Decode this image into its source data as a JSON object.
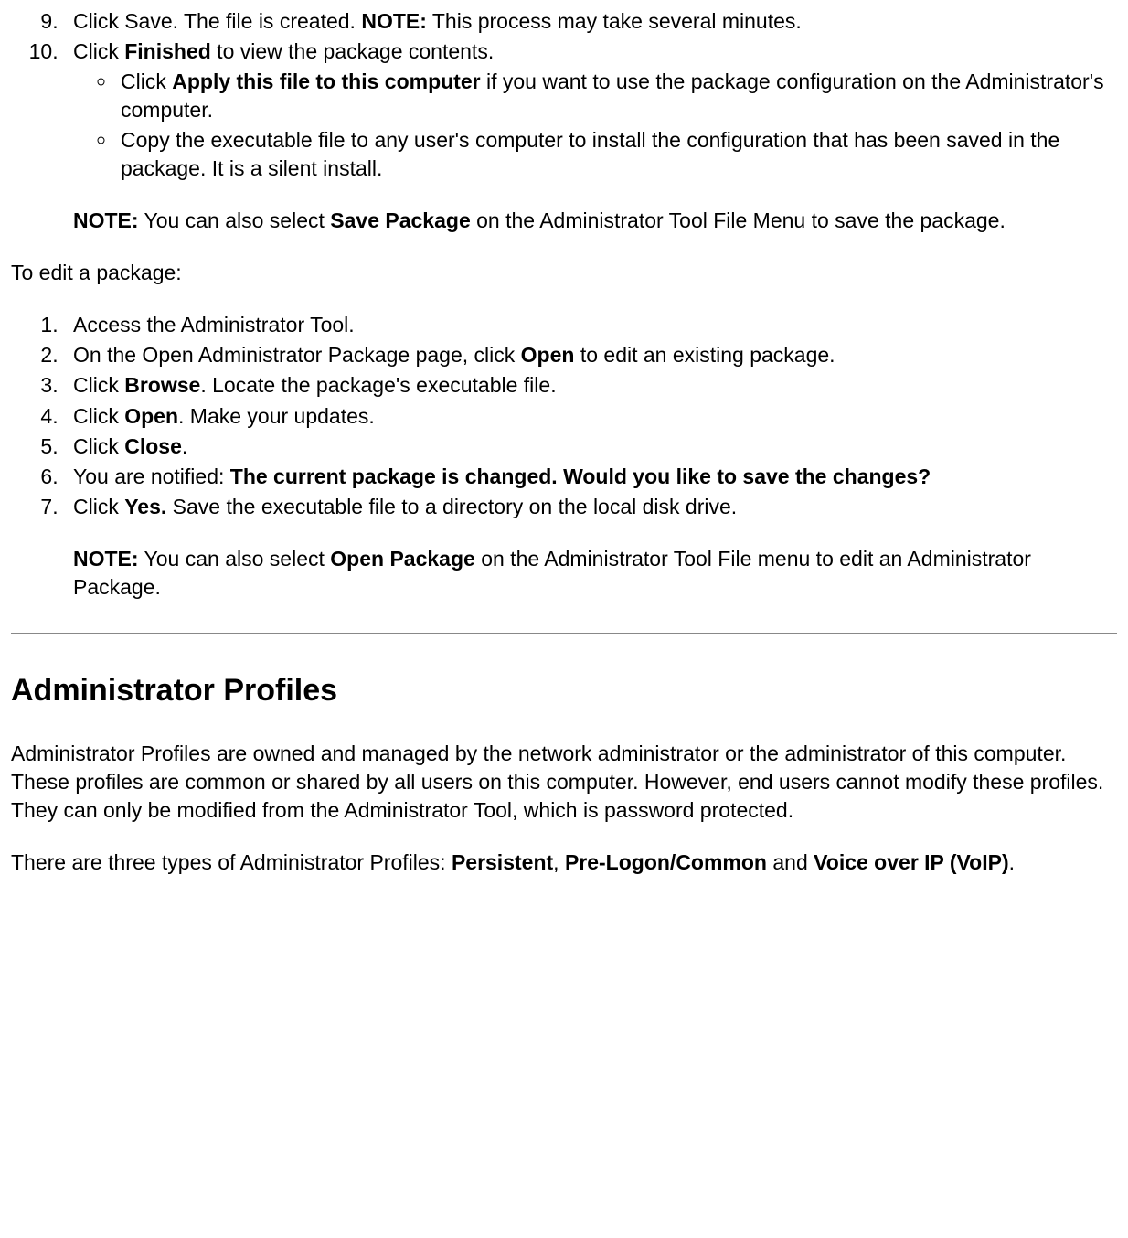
{
  "list1": {
    "item9": {
      "pre": "Click Save. The file is created. ",
      "noteLabel": "NOTE:",
      "noteText": " This process may take several minutes."
    },
    "item10": {
      "pre": "Click ",
      "bold": "Finished",
      "post": " to view the package contents.",
      "sub1": {
        "pre": "Click ",
        "bold": "Apply this file to this computer",
        "post": " if you want to use the package configuration on the Administrator's computer."
      },
      "sub2": "Copy the executable file to any user's computer to install the configuration that has been saved in the package. It is a silent install.",
      "note": {
        "label": "NOTE:",
        "t1": " You can also select ",
        "b1": "Save Package",
        "t2": " on the Administrator Tool File Menu to save the package."
      }
    }
  },
  "editHeading": "To edit a package:",
  "list2": {
    "i1": "Access the Administrator Tool.",
    "i2": {
      "pre": "On the Open Administrator Package page, click ",
      "b": "Open",
      "post": " to edit an existing package."
    },
    "i3": {
      "pre": "Click ",
      "b": "Browse",
      "post": ". Locate the package's executable file."
    },
    "i4": {
      "pre": "Click ",
      "b": "Open",
      "post": ". Make your updates."
    },
    "i5": {
      "pre": "Click ",
      "b": "Close",
      "post": "."
    },
    "i6": {
      "pre": "You are notified: ",
      "b": "The current package is changed. Would you like to save the changes?"
    },
    "i7": {
      "pre": "Click ",
      "b": "Yes.",
      "post": " Save the executable file to a directory on the local disk drive.",
      "note": {
        "label": "NOTE:",
        "t1": " You can also select ",
        "b1": "Open Package",
        "t2": " on the Administrator Tool File menu to edit an Administrator Package."
      }
    }
  },
  "section": {
    "heading": "Administrator Profiles",
    "p1": "Administrator Profiles are owned and managed by the network administrator or the administrator of this computer. These profiles are common or shared by all users on this computer. However, end users cannot modify these profiles. They can only be modified from the Administrator Tool, which is password protected.",
    "p2": {
      "t1": "There are three types of Administrator Profiles: ",
      "b1": "Persistent",
      "t2": ", ",
      "b2": "Pre-Logon/Common",
      "t3": " and ",
      "b3": "Voice over IP (VoIP)",
      "t4": "."
    }
  }
}
